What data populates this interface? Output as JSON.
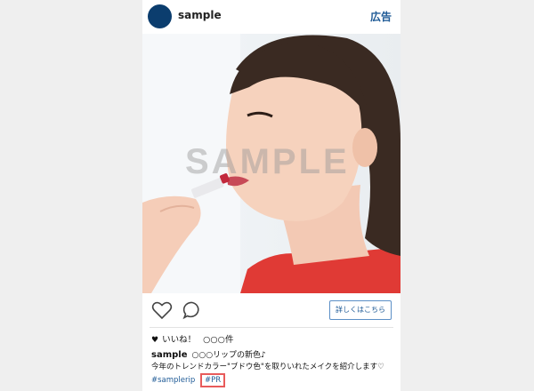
{
  "header": {
    "username": "sample",
    "ad_label": "広告"
  },
  "photo": {
    "watermark": "SAMPLE"
  },
  "actions": {
    "details_button": "詳しくはこちら"
  },
  "likes": {
    "heart": "♥",
    "label": "いいね！",
    "count": "○○○件"
  },
  "caption": {
    "account": "sample",
    "line1": "○○○リップの新色♪",
    "line2": "今年のトレンドカラー\"ブドウ色\"を取りいれたメイクを紹介します♡"
  },
  "tags": {
    "tag1": "#samplerip",
    "tag2": "#PR"
  },
  "colors": {
    "accent": "#1e5a96",
    "avatar": "#0b3d6e",
    "highlight": "#e85b5b"
  }
}
